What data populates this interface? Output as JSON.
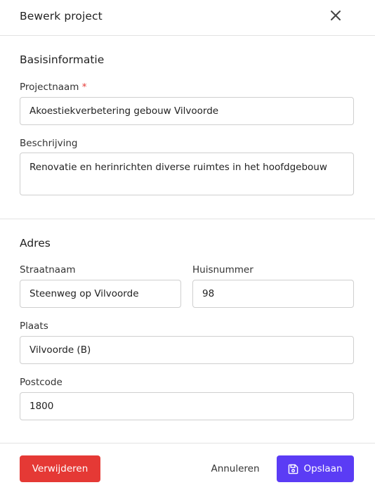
{
  "header": {
    "title": "Bewerk project",
    "close_icon": "close-icon"
  },
  "basis": {
    "title": "Basisinformatie",
    "projectnaam_label": "Projectnaam",
    "required_marker": "*",
    "projectnaam_value": "Akoestiekverbetering gebouw Vilvoorde",
    "beschrijving_label": "Beschrijving",
    "beschrijving_value": "Renovatie en herinrichten diverse ruimtes in het hoofdgebouw"
  },
  "adres": {
    "title": "Adres",
    "straatnaam_label": "Straatnaam",
    "straatnaam_value": "Steenweg op Vilvoorde",
    "huisnummer_label": "Huisnummer",
    "huisnummer_value": "98",
    "plaats_label": "Plaats",
    "plaats_value": "Vilvoorde (B)",
    "postcode_label": "Postcode",
    "postcode_value": "1800"
  },
  "footer": {
    "delete_label": "Verwijderen",
    "cancel_label": "Annuleren",
    "save_label": "Opslaan",
    "save_icon": "save-icon"
  },
  "colors": {
    "danger": "#e53935",
    "primary": "#5b3cf5",
    "border": "#cfcfcf",
    "divider": "#e3e3e3"
  }
}
